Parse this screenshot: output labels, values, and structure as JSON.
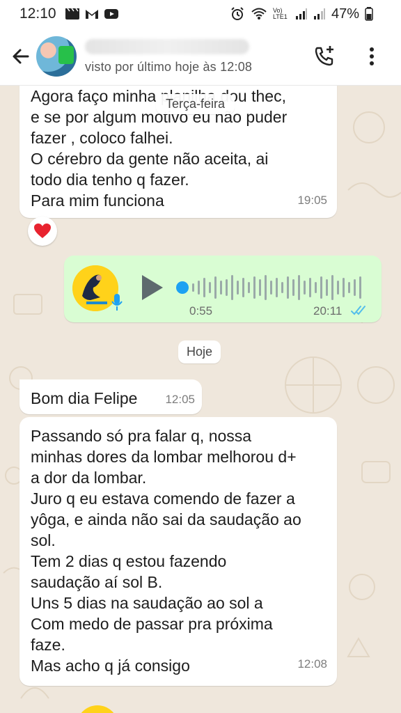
{
  "status_bar": {
    "time": "12:10",
    "battery": "47%",
    "network_label": "Vo) LTE1"
  },
  "header": {
    "last_seen": "visto por último hoje às 12:08"
  },
  "floating_day": "Terça-feira",
  "messages": {
    "m1_text": "Agora faço minha planilha dou thec,\ne se por algum motivo eu não puder\nfazer , coloco falhei.\nO cérebro da gente não aceita, ai\ntodo dia tenho q fazer.\nPara mim funciona",
    "m1_time": "19:05",
    "m1_reaction": "❤️",
    "voice_duration": "0:55",
    "voice_time": "20:11",
    "day_separator": "Hoje",
    "m2_text": "Bom dia Felipe",
    "m2_time": "12:05",
    "m3_text": "Passando só pra falar q, nossa\nminhas dores da lombar melhorou d+\na dor da lombar.\nJuro q eu estava comendo de fazer a\nyôga, e ainda não sai da saudação ao\nsol.\nTem 2 dias q estou fazendo\nsaudação aí sol B.\nUns 5 dias na saudação ao sol a\nCom medo de passar pra próxima\nfaze.\nMas acho q já consigo",
    "m3_time": "12:08"
  },
  "colors": {
    "outgoing_bubble": "#d9fdd3",
    "incoming_bubble": "#ffffff",
    "read_ticks": "#53bdeb",
    "voice_accent": "#1da1f2"
  }
}
